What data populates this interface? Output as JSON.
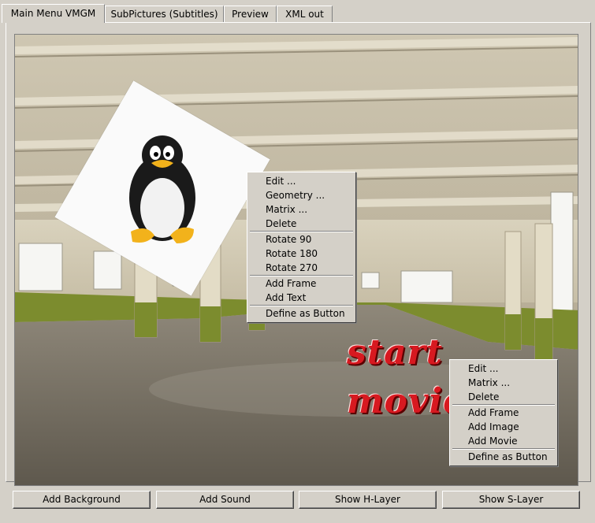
{
  "tabs": [
    "Main Menu VMGM",
    "SubPictures (Subtitles)",
    "Preview",
    "XML out"
  ],
  "active_tab": "Main Menu VMGM",
  "text_objects": [
    "start",
    "movie"
  ],
  "image_context_menu": {
    "group1": [
      "Edit ...",
      "Geometry ...",
      "Matrix ...",
      "Delete"
    ],
    "group2": [
      "Rotate 90",
      "Rotate 180",
      "Rotate 270"
    ],
    "group3": [
      "Add Frame",
      "Add Text"
    ],
    "group4": [
      "Define as Button"
    ]
  },
  "text_context_menu": {
    "group1": [
      "Edit ...",
      "Matrix ...",
      "Delete"
    ],
    "group2": [
      "Add Frame",
      "Add Image",
      "Add Movie"
    ],
    "group3": [
      "Define as Button"
    ]
  },
  "buttons": [
    "Add Background",
    "Add Sound",
    "Show H-Layer",
    "Show S-Layer"
  ],
  "colors": {
    "text_red": "#d71920",
    "wall_green": "#7c8c2e",
    "window_bg": "#d4d0c8"
  }
}
